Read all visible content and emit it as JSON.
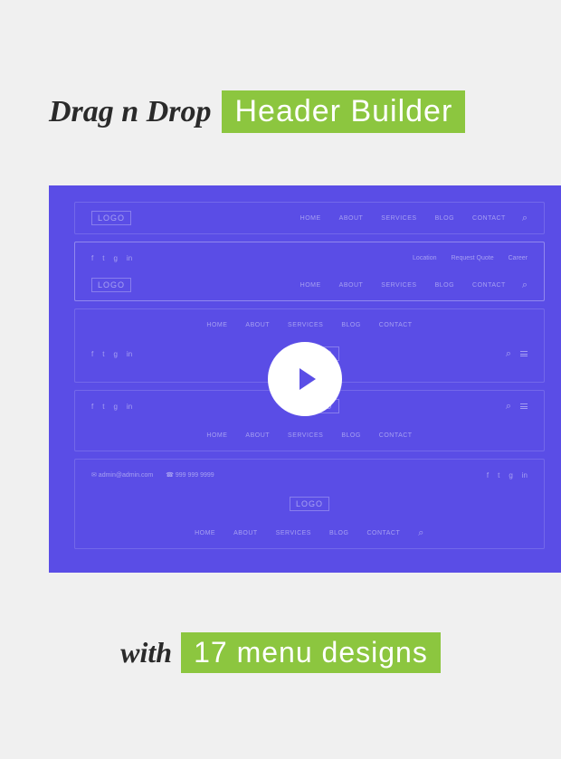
{
  "title": {
    "drag": "Drag n Drop",
    "builder": "Header Builder"
  },
  "subtitle": {
    "with": "with",
    "designs": "17 menu designs"
  },
  "mock": {
    "logo": "LOGO",
    "menu": {
      "home": "HOME",
      "about": "ABOUT",
      "services": "SERVICES",
      "blog": "BLOG",
      "contact": "CONTACT"
    },
    "toplinks": {
      "location": "Location",
      "quote": "Request Quote",
      "career": "Career"
    },
    "contact": {
      "email": "✉ admin@admin.com",
      "phone": "☎ 999 999 9999"
    }
  }
}
